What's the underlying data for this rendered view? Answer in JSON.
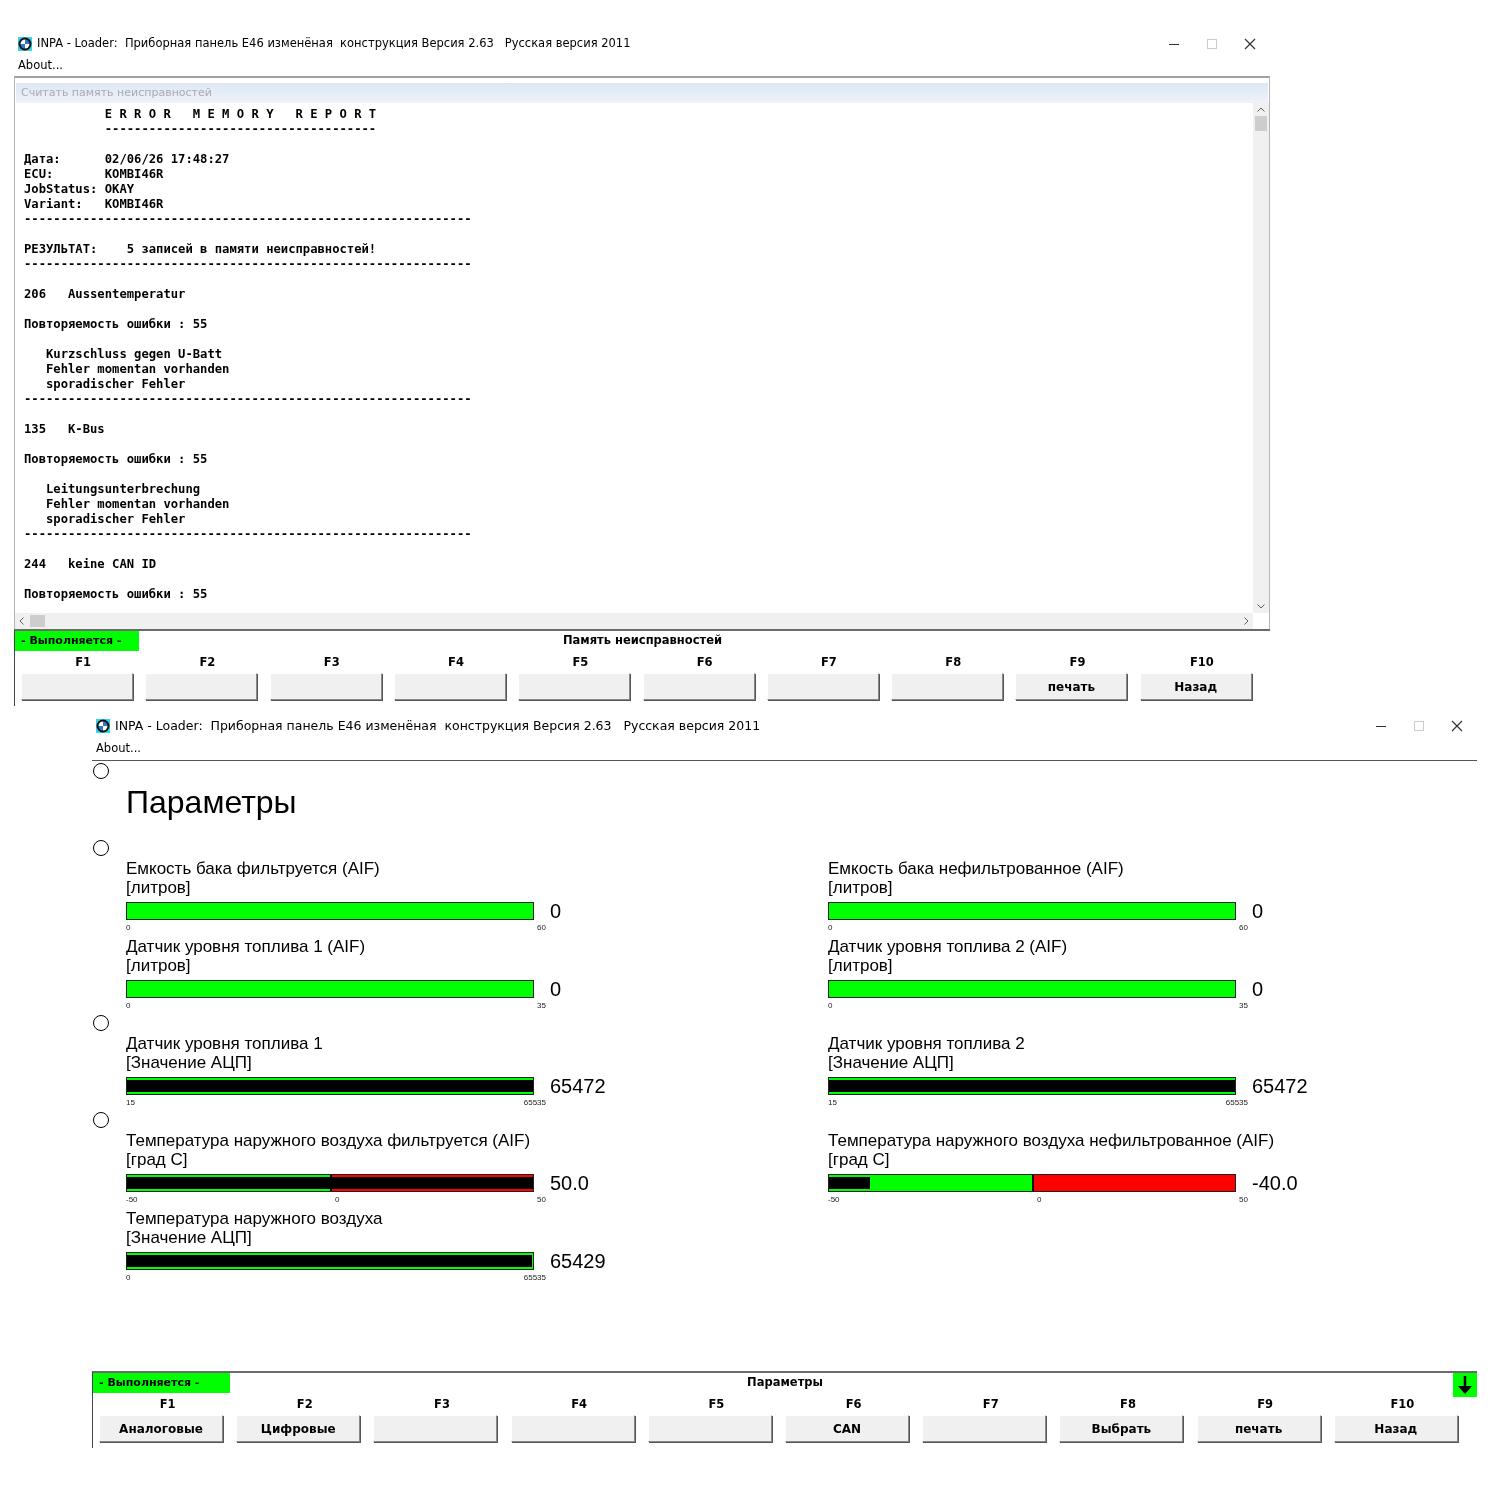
{
  "report_window": {
    "title": "INPA - Loader:  Приборная панель E46 изменёная  конструкция Версия 2.63   Русская версия 2011",
    "menu": [
      "About..."
    ],
    "panel_header": "Считать память неисправностей",
    "report_blocks": [
      [
        "           E R R O R   M E M O R Y   R E P O R T",
        "           -------------------------------------"
      ],
      [
        "Дата:      02/06/26 17:48:27",
        "ECU:       KOMBI46R",
        "JobStatus: OKAY",
        "Variant:   KOMBI46R",
        "-------------------------------------------------------------"
      ],
      [
        "РЕЗУЛЬТАТ:    5 записей в памяти неисправностей!",
        "-------------------------------------------------------------"
      ],
      [
        "206   Aussentemperatur"
      ],
      [
        "Повторяемость ошибки : 55"
      ],
      [
        "   Kurzschluss gegen U-Batt",
        "   Fehler momentan vorhanden",
        "   sporadischer Fehler",
        "-------------------------------------------------------------"
      ],
      [
        "135   K-Bus"
      ],
      [
        "Повторяемость ошибки : 55"
      ],
      [
        "   Leitungsunterbrechung",
        "   Fehler momentan vorhanden",
        "   sporadischer Fehler",
        "-------------------------------------------------------------"
      ],
      [
        "244   keine CAN ID"
      ],
      [
        "Повторяемость ошибки : 55"
      ]
    ],
    "status": "- Выполняется -",
    "screen_title": "Память неисправностей",
    "fkeys": [
      {
        "key": "F1"
      },
      {
        "key": "F2"
      },
      {
        "key": "F3"
      },
      {
        "key": "F4"
      },
      {
        "key": "F5"
      },
      {
        "key": "F6"
      },
      {
        "key": "F7"
      },
      {
        "key": "F8"
      },
      {
        "key": "F9",
        "label": "печать"
      },
      {
        "key": "F10",
        "label": "Назад"
      }
    ]
  },
  "parameters_window": {
    "title": "INPA - Loader:  Приборная панель E46 изменёная  конструкция Версия 2.63   Русская версия 2011",
    "menu": [
      "About..."
    ],
    "sections": [
      {
        "selected": false,
        "heading": "Параметры"
      },
      {
        "selected": false,
        "gauges": [
          {
            "title": "Емкость бака фильтруется (AIF)",
            "unit": "[литров]",
            "kind": "plain",
            "level": 0,
            "value": "0",
            "ticks": [
              "0",
              "60"
            ]
          },
          {
            "title": "Емкость бака нефильтрованное (AIF)",
            "unit": "[литров]",
            "kind": "plain",
            "level": 0,
            "value": "0",
            "ticks": [
              "0",
              "60"
            ]
          },
          {
            "title": "Датчик уровня топлива 1 (AIF)",
            "unit": "[литров]",
            "kind": "plain",
            "level": 0,
            "value": "0",
            "ticks": [
              "0",
              "35"
            ]
          },
          {
            "title": "Датчик уровня топлива 2 (AIF)",
            "unit": "[литров]",
            "kind": "plain",
            "level": 0,
            "value": "0",
            "ticks": [
              "0",
              "35"
            ]
          }
        ]
      },
      {
        "selected": false,
        "gauges": [
          {
            "title": "Датчик уровня топлива 1",
            "unit": "[Значение АЦП]",
            "kind": "plain",
            "level": 0.999,
            "value": "65472",
            "ticks": [
              "15",
              "65535"
            ]
          },
          {
            "title": "Датчик уровня топлива 2",
            "unit": "[Значение АЦП]",
            "kind": "plain",
            "level": 0.999,
            "value": "65472",
            "ticks": [
              "15",
              "65535"
            ]
          }
        ]
      },
      {
        "selected": false,
        "gauges": [
          {
            "title": "Температура наружного воздуха фильтруется (AIF)",
            "unit": "[град С]",
            "kind": "split",
            "level": 1,
            "value": "50.0",
            "ticks": [
              "-50",
              "0",
              "50"
            ]
          },
          {
            "title": "Температура наружного воздуха нефильтрованное (AIF)",
            "unit": "[град С]",
            "kind": "split",
            "level": 0.1,
            "value": "-40.0",
            "ticks": [
              "-50",
              "0",
              "50"
            ]
          },
          {
            "title": "Температура наружного воздуха",
            "unit": "[Значение АЦП]",
            "kind": "plain",
            "level": 0.998,
            "value": "65429",
            "ticks": [
              "0",
              "65535"
            ]
          }
        ]
      }
    ],
    "status": "- Выполняется -",
    "screen_title": "Параметры",
    "fkeys": [
      {
        "key": "F1",
        "label": "Аналоговые"
      },
      {
        "key": "F2",
        "label": "Цифровые"
      },
      {
        "key": "F3"
      },
      {
        "key": "F4"
      },
      {
        "key": "F5"
      },
      {
        "key": "F6",
        "label": "CAN"
      },
      {
        "key": "F7"
      },
      {
        "key": "F8",
        "label": "Выбрать"
      },
      {
        "key": "F9",
        "label": "печать"
      },
      {
        "key": "F10",
        "label": "Назад"
      }
    ]
  }
}
